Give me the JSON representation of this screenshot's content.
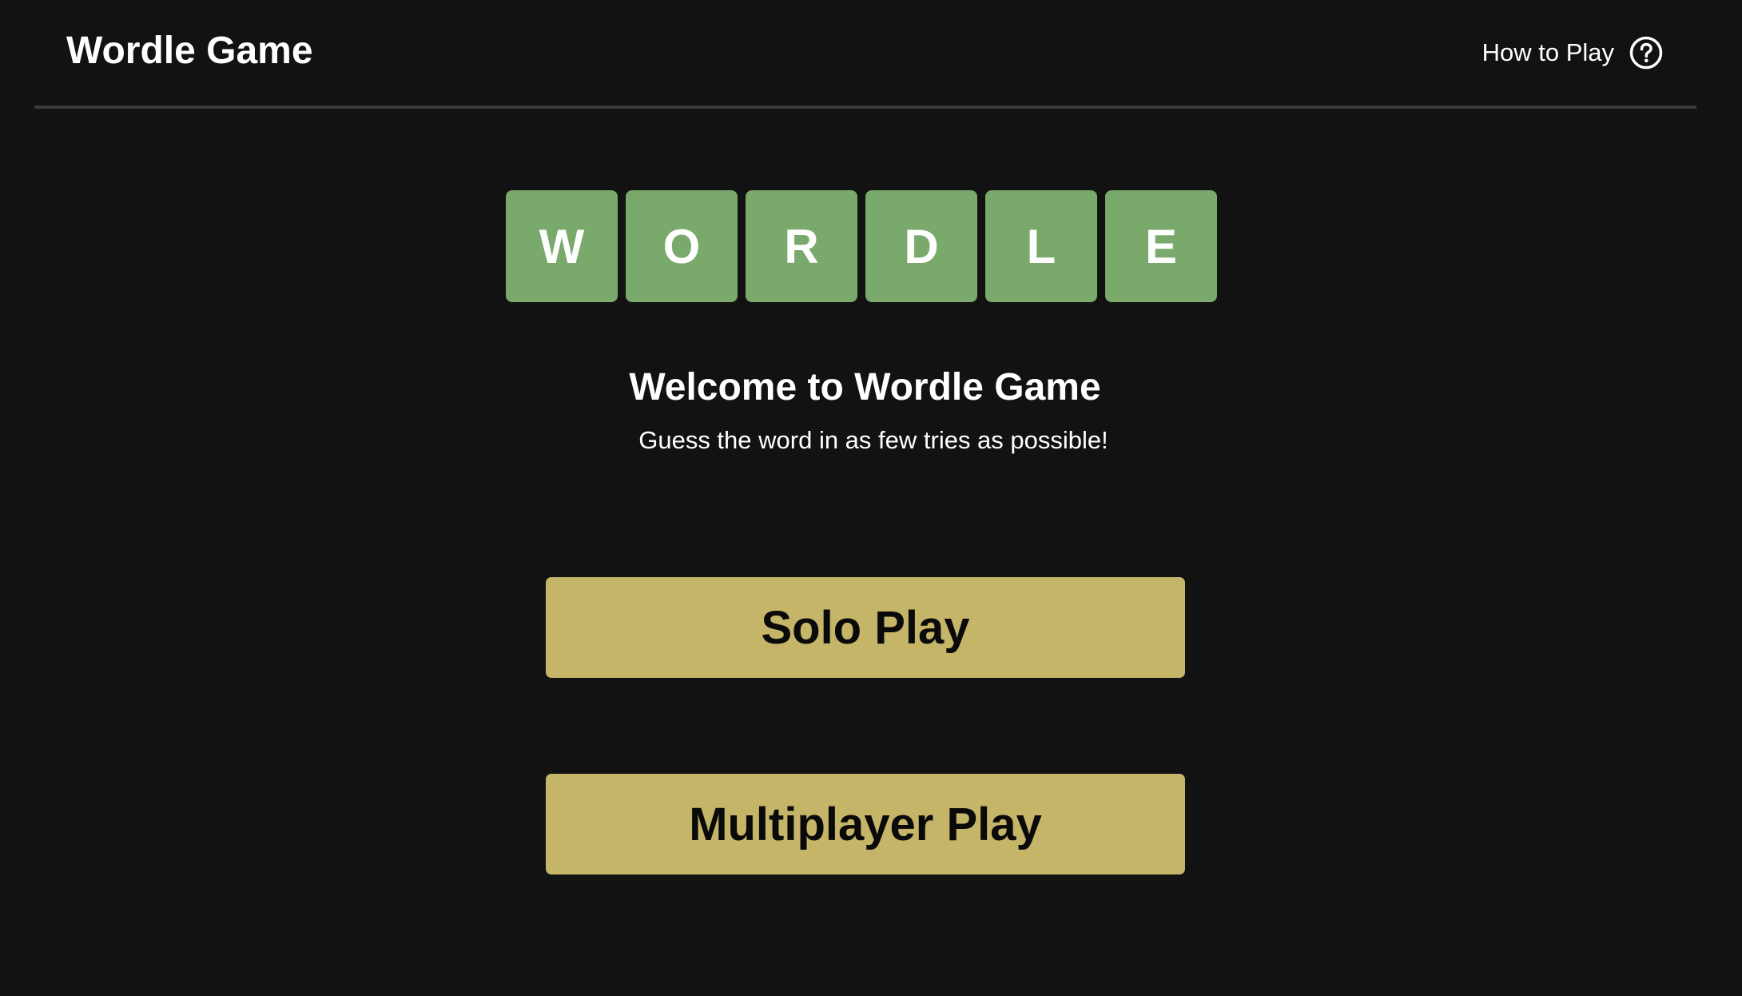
{
  "header": {
    "title": "Wordle Game",
    "how_to_play_label": "How to Play",
    "help_icon": "question-circle-icon"
  },
  "hero": {
    "tiles": [
      "W",
      "O",
      "R",
      "D",
      "L",
      "E"
    ],
    "tile_color": "#79a96b",
    "title": "Welcome to Wordle Game",
    "subtitle": "Guess the word in as few tries as possible!"
  },
  "actions": {
    "solo_label": "Solo Play",
    "multiplayer_label": "Multiplayer Play",
    "button_color": "#c5b569"
  },
  "theme": {
    "background": "#121212",
    "divider": "#3a3a3c",
    "text": "#ffffff"
  }
}
